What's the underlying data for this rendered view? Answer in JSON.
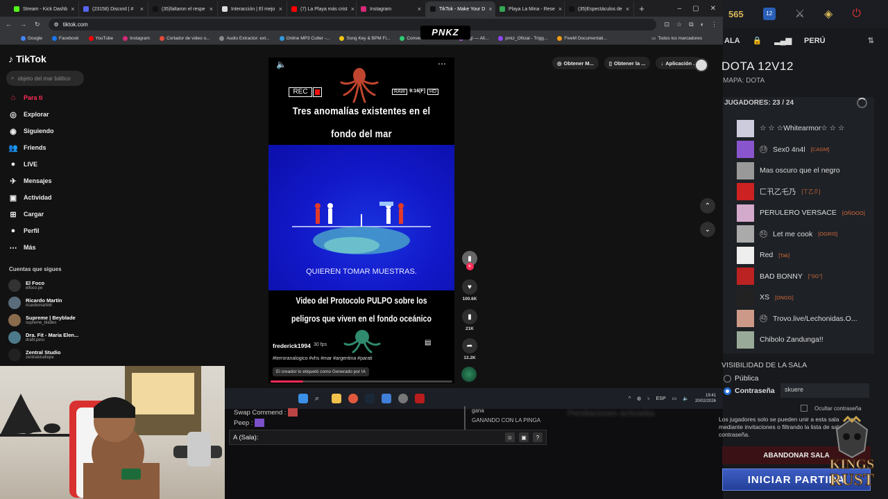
{
  "browser": {
    "tabs": [
      {
        "label": "Stream - Kick Dashb",
        "color": "#53fc18"
      },
      {
        "label": "(23158) Discord | #",
        "color": "#5865f2"
      },
      {
        "label": "(35)faltaron el respe",
        "color": "#111111"
      },
      {
        "label": "Interacción | El mejo",
        "color": "#dddddd"
      },
      {
        "label": "(7) La Playa más crist",
        "color": "#ff0000"
      },
      {
        "label": "Instagram",
        "color": "#d62976"
      },
      {
        "label": "TikTok - Make Your D",
        "color": "#111111",
        "active": true
      },
      {
        "label": "Playa La Mina - Rese",
        "color": "#34a853"
      },
      {
        "label": "(35)Espectáculos de",
        "color": "#111111"
      }
    ],
    "url": "tiktok.com",
    "bookmarks": [
      {
        "label": "Google",
        "color": "#4285f4"
      },
      {
        "label": "Facebook",
        "color": "#1877f2"
      },
      {
        "label": "YouTube",
        "color": "#ff0000"
      },
      {
        "label": "Instagram",
        "color": "#d62976"
      },
      {
        "label": "Cortador de video o...",
        "color": "#e74c3c"
      },
      {
        "label": "Audio Extractor: ext...",
        "color": "#888888"
      },
      {
        "label": "Online MP3 Cutter -...",
        "color": "#3498db"
      },
      {
        "label": "Song Key & BPM Fi...",
        "color": "#f1c40f"
      },
      {
        "label": "Conversor de Letra...",
        "color": "#2ecc71"
      },
      {
        "label": "...gi — All...",
        "color": "#9b59b6"
      },
      {
        "label": "pnkz_Oficial - Trigg...",
        "color": "#9146ff"
      },
      {
        "label": "FiveM Documentati...",
        "color": "#f39c12"
      }
    ],
    "bookmarks_folder": "Todos los marcadores"
  },
  "overlay_badge": "PNKZ",
  "tiktok": {
    "logo": "TikTok",
    "search_placeholder": "objeto del mar báltico",
    "nav": [
      {
        "label": "Para ti",
        "icon": "home-icon",
        "glyph": "⌂",
        "active": true
      },
      {
        "label": "Explorar",
        "icon": "compass-icon",
        "glyph": "◎"
      },
      {
        "label": "Siguiendo",
        "icon": "following-icon",
        "glyph": "◉"
      },
      {
        "label": "Friends",
        "icon": "friends-icon",
        "glyph": "👥"
      },
      {
        "label": "LIVE",
        "icon": "live-icon",
        "glyph": "●"
      },
      {
        "label": "Mensajes",
        "icon": "messages-icon",
        "glyph": "✈"
      },
      {
        "label": "Actividad",
        "icon": "activity-icon",
        "glyph": "▣"
      },
      {
        "label": "Cargar",
        "icon": "upload-icon",
        "glyph": "⊞"
      },
      {
        "label": "Perfil",
        "icon": "profile-icon",
        "glyph": "●"
      },
      {
        "label": "Más",
        "icon": "more-icon",
        "glyph": "⋯"
      }
    ],
    "following_header": "Cuentas que sigues",
    "following": [
      {
        "name": "El Foco",
        "handle": "elfoco.pe"
      },
      {
        "name": "Ricardo Martín",
        "handle": "ricardomartinll"
      },
      {
        "name": "Supreme | Beyblade",
        "handle": "supreme_blades"
      },
      {
        "name": "Dra. Fit - Maria Elen...",
        "handle": "drafit.peru"
      },
      {
        "name": "Zentral Studio",
        "handle": "zentralstudiope"
      }
    ],
    "top_actions": [
      "Obtener M...",
      "Obtener la ...",
      "Aplicación ..."
    ],
    "video": {
      "rec": "REC",
      "raw": "RAW",
      "time": "9:16[F]",
      "hd": "HD",
      "title_line1": "Tres anomalías existentes en el",
      "title_line2": "fondo del mar",
      "caption": "QUIEREN TOMAR MUESTRAS.",
      "subtitle_line1": "Video del Protocolo PULPO sobre los",
      "subtitle_line2": "peligros que viven en el fondo oceánico",
      "author": "frederick1994",
      "fps": "30 fps",
      "hashtags": "#terroranalogico #vhs #mar #argentina #parati",
      "ai_label": "El creador lo etiquetó como Generado por IA",
      "progress": 0.18
    },
    "stats": {
      "likes": "100.6K",
      "saves": "21K",
      "shares": "13.2K"
    }
  },
  "taskbar": {
    "lang": "ESP",
    "time": "19:41",
    "date": "20/02/2026"
  },
  "chat": {
    "lines": [
      {
        "user": "Swap Commend",
        "text": ""
      },
      {
        "user": "Peep",
        "text": ""
      }
    ],
    "side_lines": [
      "gana",
      "GANANDO CON LA PINGA"
    ],
    "input_label": "A (Sala):",
    "blurred": "Pendiaciones activadas"
  },
  "dota": {
    "gold": "565",
    "level_badge": "12",
    "room_label": "ALA",
    "region": "PERÚ",
    "title": "DOTA 12V12",
    "map": "MAPA: DOTA",
    "players_header": "JUGADORES: 23 / 24",
    "players": [
      {
        "name": "☆ ☆ ☆Whitearmor☆ ☆ ☆",
        "tag": "",
        "lvl": "",
        "color": "#ccd"
      },
      {
        "name": "Sex0 4n4l",
        "tag": "[CAGM]",
        "lvl": "13",
        "color": "#8855cc"
      },
      {
        "name": "Mas oscuro que el negro",
        "tag": "",
        "lvl": "",
        "color": "#999"
      },
      {
        "name": "匚卂乙乇乃",
        "tag": "[ㄒ乙卩]",
        "lvl": "",
        "color": "#c22"
      },
      {
        "name": "PERULERO VERSACE",
        "tag": "[OÑOOO]",
        "lvl": "",
        "color": "#d4aacc"
      },
      {
        "name": "Let me cook",
        "tag": "[OGRIS]",
        "lvl": "51",
        "color": "#aaa"
      },
      {
        "name": "Red",
        "tag": "[Tak]",
        "lvl": "",
        "color": "#eee"
      },
      {
        "name": "BAD BONNY",
        "tag": "[\"SG\"]",
        "lvl": "",
        "color": "#b22"
      },
      {
        "name": "XS",
        "tag": "[DNGG]",
        "lvl": "",
        "color": "#222"
      },
      {
        "name": "Trovo.live/Lechonidas.O...",
        "tag": "",
        "lvl": "42",
        "color": "#c98"
      },
      {
        "name": "Chibolo Zandunga!!",
        "tag": "",
        "lvl": "",
        "color": "#9a9"
      }
    ],
    "visibility_label": "VISIBILIDAD DE LA SALA",
    "option_public": "Pública",
    "option_password": "Contraseña",
    "password_value": "skuere",
    "hide_password": "Ocultar contraseña",
    "note": "Los jugadores solo se pueden unir a esta sala mediante invitaciones o filtrando la lista de salas por contraseña.",
    "abandon": "ABANDONAR SALA",
    "start": "INICIAR PARTIDA"
  },
  "watermark": "KINGS RUST"
}
